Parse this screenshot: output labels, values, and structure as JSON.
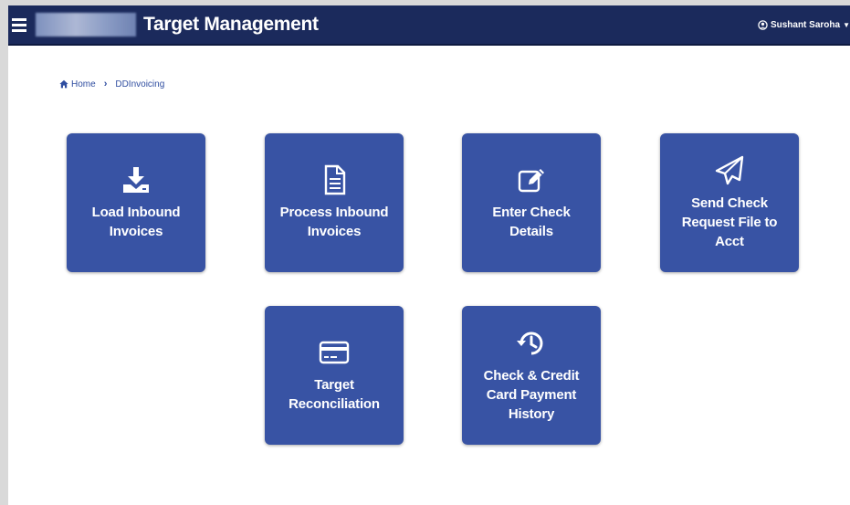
{
  "header": {
    "title": "Target Management",
    "user_name": "Sushant Saroha",
    "menu_icon": "hamburger-icon",
    "user_icon": "user-circle-icon",
    "background": "#1b2a5c"
  },
  "breadcrumb": {
    "home": "Home",
    "current": "DDInvoicing"
  },
  "tiles": [
    {
      "label": "Load Inbound Invoices",
      "icon": "download-icon"
    },
    {
      "label": "Process Inbound Invoices",
      "icon": "document-icon"
    },
    {
      "label": "Enter Check Details",
      "icon": "edit-icon"
    },
    {
      "label": "Send Check Request File to Acct",
      "icon": "paper-plane-icon"
    },
    {
      "label": "Target Reconciliation",
      "icon": "credit-card-icon"
    },
    {
      "label": "Check & Credit Card Payment History",
      "icon": "history-icon"
    }
  ],
  "colors": {
    "tile": "#3853a4",
    "link": "#2f4da0"
  }
}
